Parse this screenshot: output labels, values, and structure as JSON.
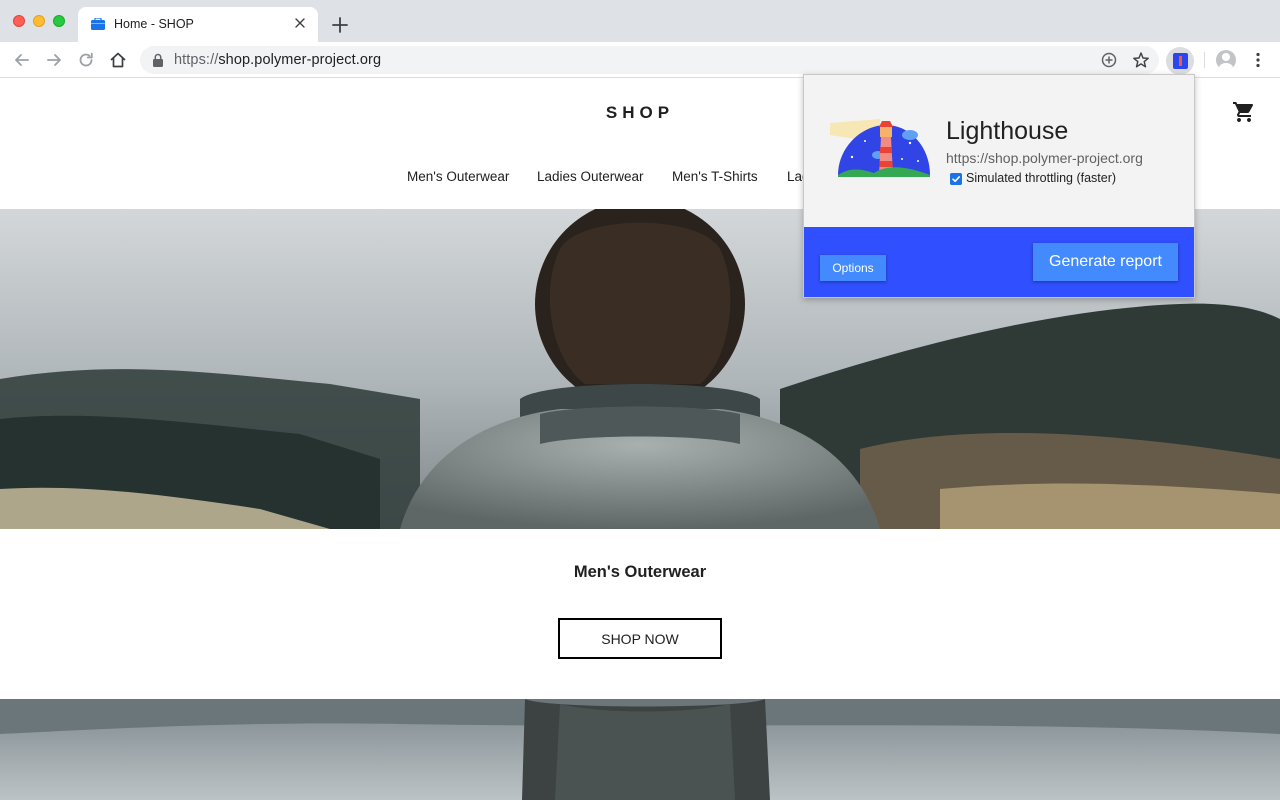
{
  "browser": {
    "tab": {
      "title": "Home - SHOP"
    },
    "address_bar": {
      "protocol": "https://",
      "host": "shop.polymer-project.org"
    }
  },
  "shop": {
    "logo": "SHOP",
    "nav": [
      "Men's Outerwear",
      "Ladies Outerwear",
      "Men's T-Shirts",
      "Lad"
    ],
    "hero_category": "Men's Outerwear",
    "shop_now_label": "SHOP NOW"
  },
  "lighthouse_popup": {
    "title": "Lighthouse",
    "url": "https://shop.polymer-project.org",
    "throttling_label": "Simulated throttling (faster)",
    "throttling_checked": true,
    "options_label": "Options",
    "generate_label": "Generate report"
  },
  "colors": {
    "popup_footer": "#304ffe",
    "popup_button": "#448aff",
    "tabstrip": "#dee1e6"
  },
  "icons": [
    "back-icon",
    "forward-icon",
    "reload-icon",
    "home-icon",
    "lock-icon",
    "add-icon",
    "star-icon",
    "lighthouse-extension-icon",
    "profile-icon",
    "more-icon",
    "cart-icon"
  ]
}
